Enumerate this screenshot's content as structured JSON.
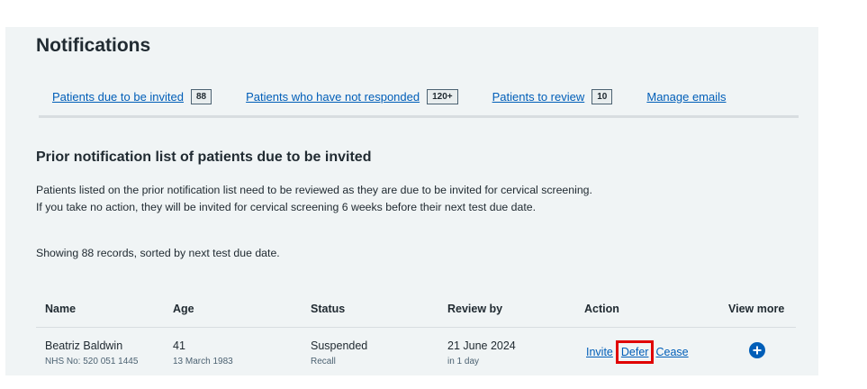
{
  "page": {
    "title": "Notifications"
  },
  "tabs": [
    {
      "label": "Patients due to be invited",
      "count": "88"
    },
    {
      "label": "Patients who have not responded",
      "count": "120+"
    },
    {
      "label": "Patients to review",
      "count": "10"
    },
    {
      "label": "Manage emails",
      "count": ""
    }
  ],
  "section": {
    "heading": "Prior notification list of patients due to be invited",
    "description": "Patients listed on the prior notification list need to be reviewed as they are due to be invited for cervical screening. If you take no action, they will be invited for cervical screening 6 weeks before their next test due date.",
    "summary": "Showing 88 records, sorted by next test due date."
  },
  "table": {
    "headers": {
      "name": "Name",
      "age": "Age",
      "status": "Status",
      "review_by": "Review by",
      "action": "Action",
      "view_more": "View more"
    },
    "rows": [
      {
        "name": "Beatriz Baldwin",
        "nhs_no": "NHS No: 520 051 1445",
        "age": "41",
        "dob": "13 March 1983",
        "status": "Suspended",
        "status_reason": "Recall",
        "review_by": "21 June 2024",
        "review_in": "in 1 day",
        "actions": {
          "invite": "Invite",
          "defer": "Defer",
          "cease": "Cease"
        },
        "view_more_icon": "plus-circle-icon"
      }
    ]
  },
  "colors": {
    "link": "#005eb8",
    "panel_bg": "#f0f4f5",
    "highlight": "#e00000"
  }
}
